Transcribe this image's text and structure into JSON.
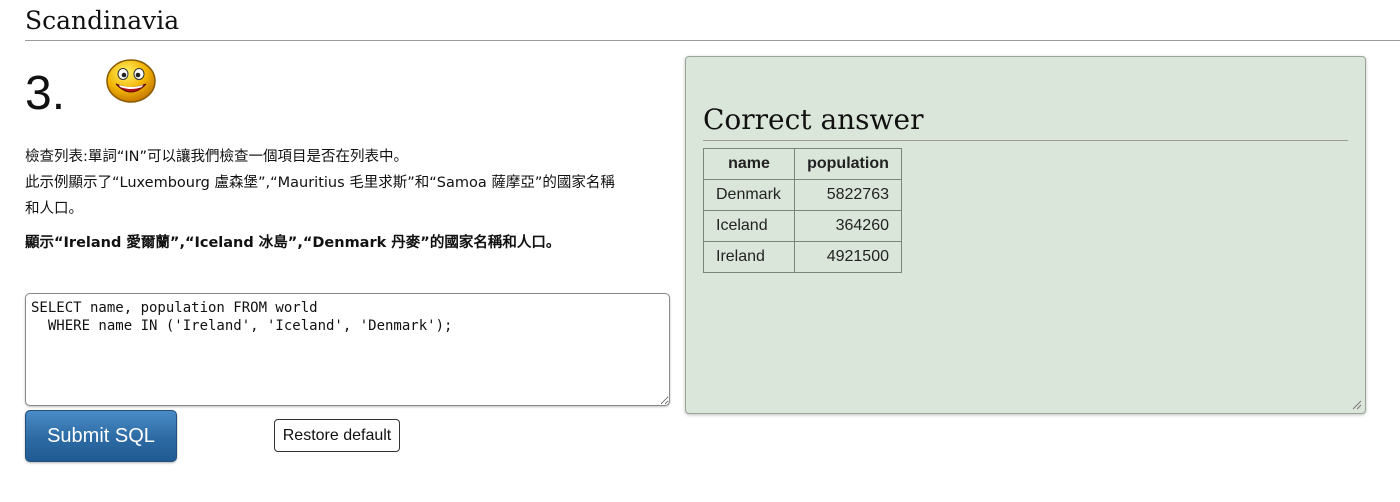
{
  "page": {
    "title": "Scandinavia"
  },
  "question": {
    "number": "3.",
    "line1": "檢查列表:單詞“IN”可以讓我們檢查一個項目是否在列表中。",
    "line2": "此示例顯示了“Luxembourg 盧森堡”,“Mauritius 毛里求斯”和“Samoa 薩摩亞”的國家名稱",
    "line3": "和人口。",
    "task": "顯示“Ireland 愛爾蘭”,“Iceland 冰島”,“Denmark 丹麥”的國家名稱和人口。",
    "icon": "smiley-icon"
  },
  "editor": {
    "sql": "SELECT name, population FROM world\n  WHERE name IN ('Ireland', 'Iceland', 'Denmark');"
  },
  "buttons": {
    "submit": "Submit SQL",
    "restore": "Restore default"
  },
  "answer": {
    "title": "Correct answer",
    "columns": [
      "name",
      "population"
    ],
    "rows": [
      [
        "Denmark",
        "5822763"
      ],
      [
        "Iceland",
        "364260"
      ],
      [
        "Ireland",
        "4921500"
      ]
    ],
    "background": "#dbe6da"
  },
  "colors": {
    "submit_button": "#2d6aa3"
  }
}
